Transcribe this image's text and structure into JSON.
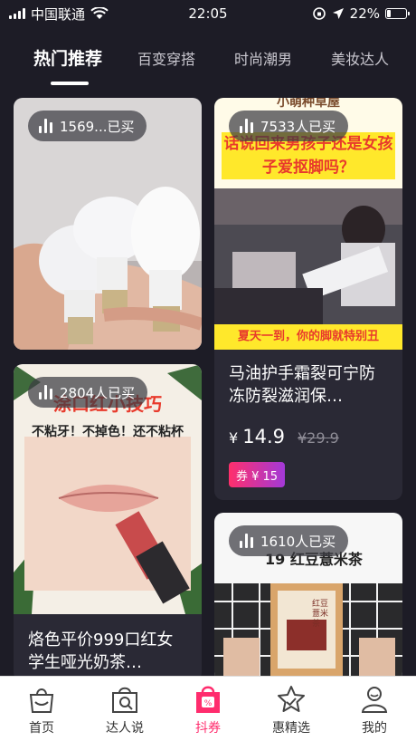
{
  "status_bar": {
    "carrier": "中国联通",
    "time": "22:05",
    "battery": "22%",
    "battery_level": 0.22
  },
  "tabs": [
    {
      "label": "热门推荐",
      "active": true
    },
    {
      "label": "百变穿搭",
      "active": false
    },
    {
      "label": "时尚潮男",
      "active": false
    },
    {
      "label": "美妆达人",
      "active": false
    }
  ],
  "products": [
    {
      "sales": "1569...已买",
      "icon": "light-bulb-photo"
    },
    {
      "sales": "7533人已买",
      "image_caption_top": "小萌种草屋",
      "image_headline": "话说回来男孩子还是女孩子爱抠脚吗？",
      "image_caption_bottom": "夏天一到，你的脚就特别丑",
      "title": "马油护手霜裂可宁防冻防裂滋润保…",
      "currency": "¥",
      "price": "14.9",
      "original_price": "¥29.9",
      "coupon": "券 ¥ 15"
    },
    {
      "sales": "2804人已买",
      "image_headline": "涂口红小技巧",
      "image_subline": "不粘牙！不掉色！还不粘杯",
      "title": "烙色平价999口红女学生哑光奶茶…"
    },
    {
      "sales": "1610人已买",
      "image_headline": "19 红豆薏米茶",
      "package_text": "红豆薏米茶"
    }
  ],
  "bottom_nav": [
    {
      "label": "首页",
      "icon": "shopping-bag-icon",
      "active": false
    },
    {
      "label": "达人说",
      "icon": "talent-search-icon",
      "active": false
    },
    {
      "label": "抖券",
      "icon": "coupon-bag-icon",
      "active": true
    },
    {
      "label": "惠精选",
      "icon": "star-pick-icon",
      "active": false
    },
    {
      "label": "我的",
      "icon": "profile-icon",
      "active": false
    }
  ],
  "colors": {
    "background": "#1d1c26",
    "card": "#2a2935",
    "accent": "#ff2c6d",
    "coupon_gradient_start": "#ff2f6c",
    "coupon_gradient_end": "#a339d8",
    "headline_red": "#e83a2c",
    "banner_yellow": "#ffe82b"
  }
}
